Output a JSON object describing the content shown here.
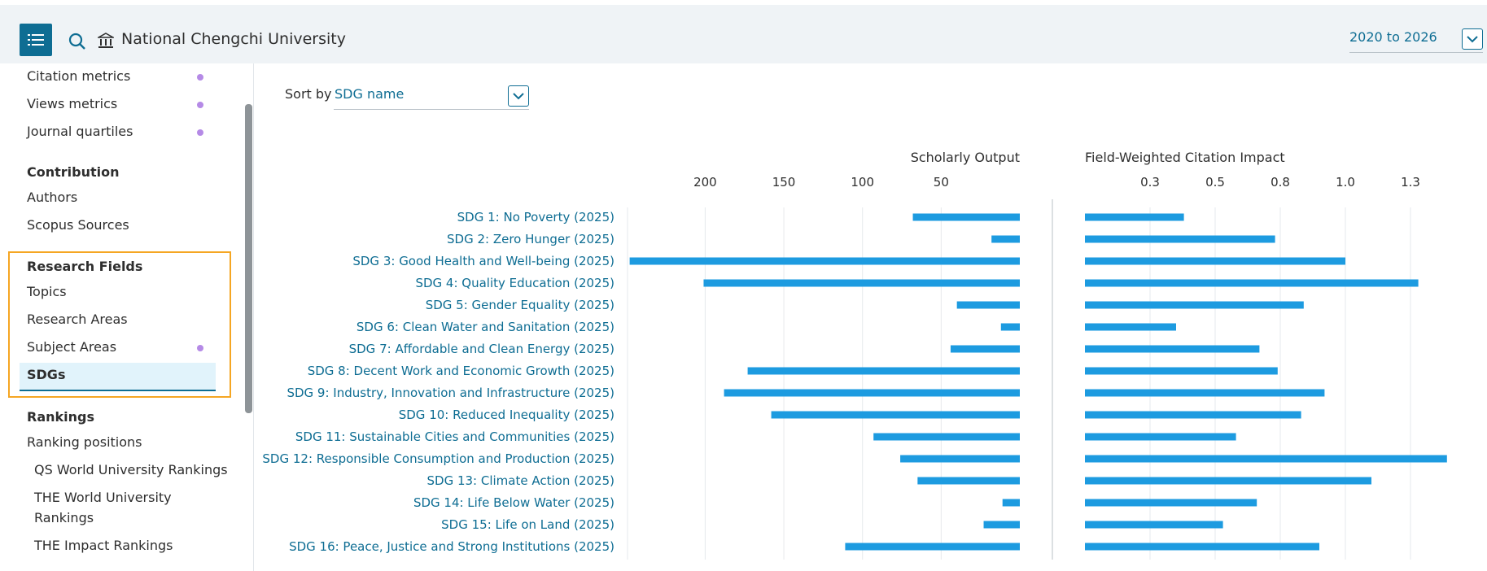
{
  "header": {
    "institution": "National Chengchi University",
    "date_range": "2020 to 2026"
  },
  "sidebar": {
    "items_top": [
      {
        "label": "Citation metrics",
        "dot": true
      },
      {
        "label": "Views metrics",
        "dot": true
      },
      {
        "label": "Journal quartiles",
        "dot": true
      }
    ],
    "contribution": {
      "heading": "Contribution",
      "items": [
        "Authors",
        "Scopus Sources"
      ]
    },
    "research_fields": {
      "heading": "Research Fields",
      "items": [
        "Topics",
        "Research Areas",
        "Subject Areas",
        "SDGs"
      ]
    },
    "rankings": {
      "heading": "Rankings",
      "items": [
        "Ranking positions",
        "QS World University Rankings",
        "THE World University",
        "Rankings",
        "THE Impact Rankings"
      ]
    }
  },
  "sort": {
    "label": "Sort by",
    "value": "SDG name"
  },
  "colors": {
    "bar": "#1d9be0",
    "link": "#0e6d93",
    "accent_box": "#f5a623",
    "dot": "#b58ae6"
  },
  "chart_data": [
    {
      "type": "bar",
      "title": "Scholarly Output",
      "orientation": "horizontal-reversed",
      "tick_labels": [
        "200",
        "150",
        "100",
        "50"
      ],
      "ticks": [
        200,
        150,
        100,
        50
      ],
      "xlim": [
        0,
        250
      ],
      "categories": [
        "SDG 1: No Poverty (2025)",
        "SDG 2: Zero Hunger (2025)",
        "SDG 3: Good Health and Well-being (2025)",
        "SDG 4: Quality Education (2025)",
        "SDG 5: Gender Equality (2025)",
        "SDG 6: Clean Water and Sanitation (2025)",
        "SDG 7: Affordable and Clean Energy (2025)",
        "SDG 8: Decent Work and Economic Growth (2025)",
        "SDG 9: Industry, Innovation and Infrastructure (2025)",
        "SDG 10: Reduced Inequality (2025)",
        "SDG 11: Sustainable Cities and Communities (2025)",
        "SDG 12: Responsible Consumption and Production (2025)",
        "SDG 13: Climate Action (2025)",
        "SDG 14: Life Below Water (2025)",
        "SDG 15: Life on Land (2025)",
        "SDG 16: Peace, Justice and Strong Institutions (2025)"
      ],
      "values": [
        68,
        18,
        248,
        201,
        40,
        12,
        44,
        173,
        188,
        158,
        93,
        76,
        65,
        11,
        23,
        111
      ]
    },
    {
      "type": "bar",
      "title": "Field-Weighted Citation Impact",
      "orientation": "horizontal",
      "tick_labels": [
        "0.3",
        "0.5",
        "0.8",
        "1.0",
        "1.3"
      ],
      "ticks": [
        0.25,
        0.5,
        0.75,
        1.0,
        1.25
      ],
      "xlim": [
        0,
        1.45
      ],
      "values": [
        0.38,
        0.73,
        1.0,
        1.28,
        0.84,
        0.35,
        0.67,
        0.74,
        0.92,
        0.83,
        0.58,
        1.39,
        1.1,
        0.66,
        0.53,
        0.9
      ]
    }
  ]
}
